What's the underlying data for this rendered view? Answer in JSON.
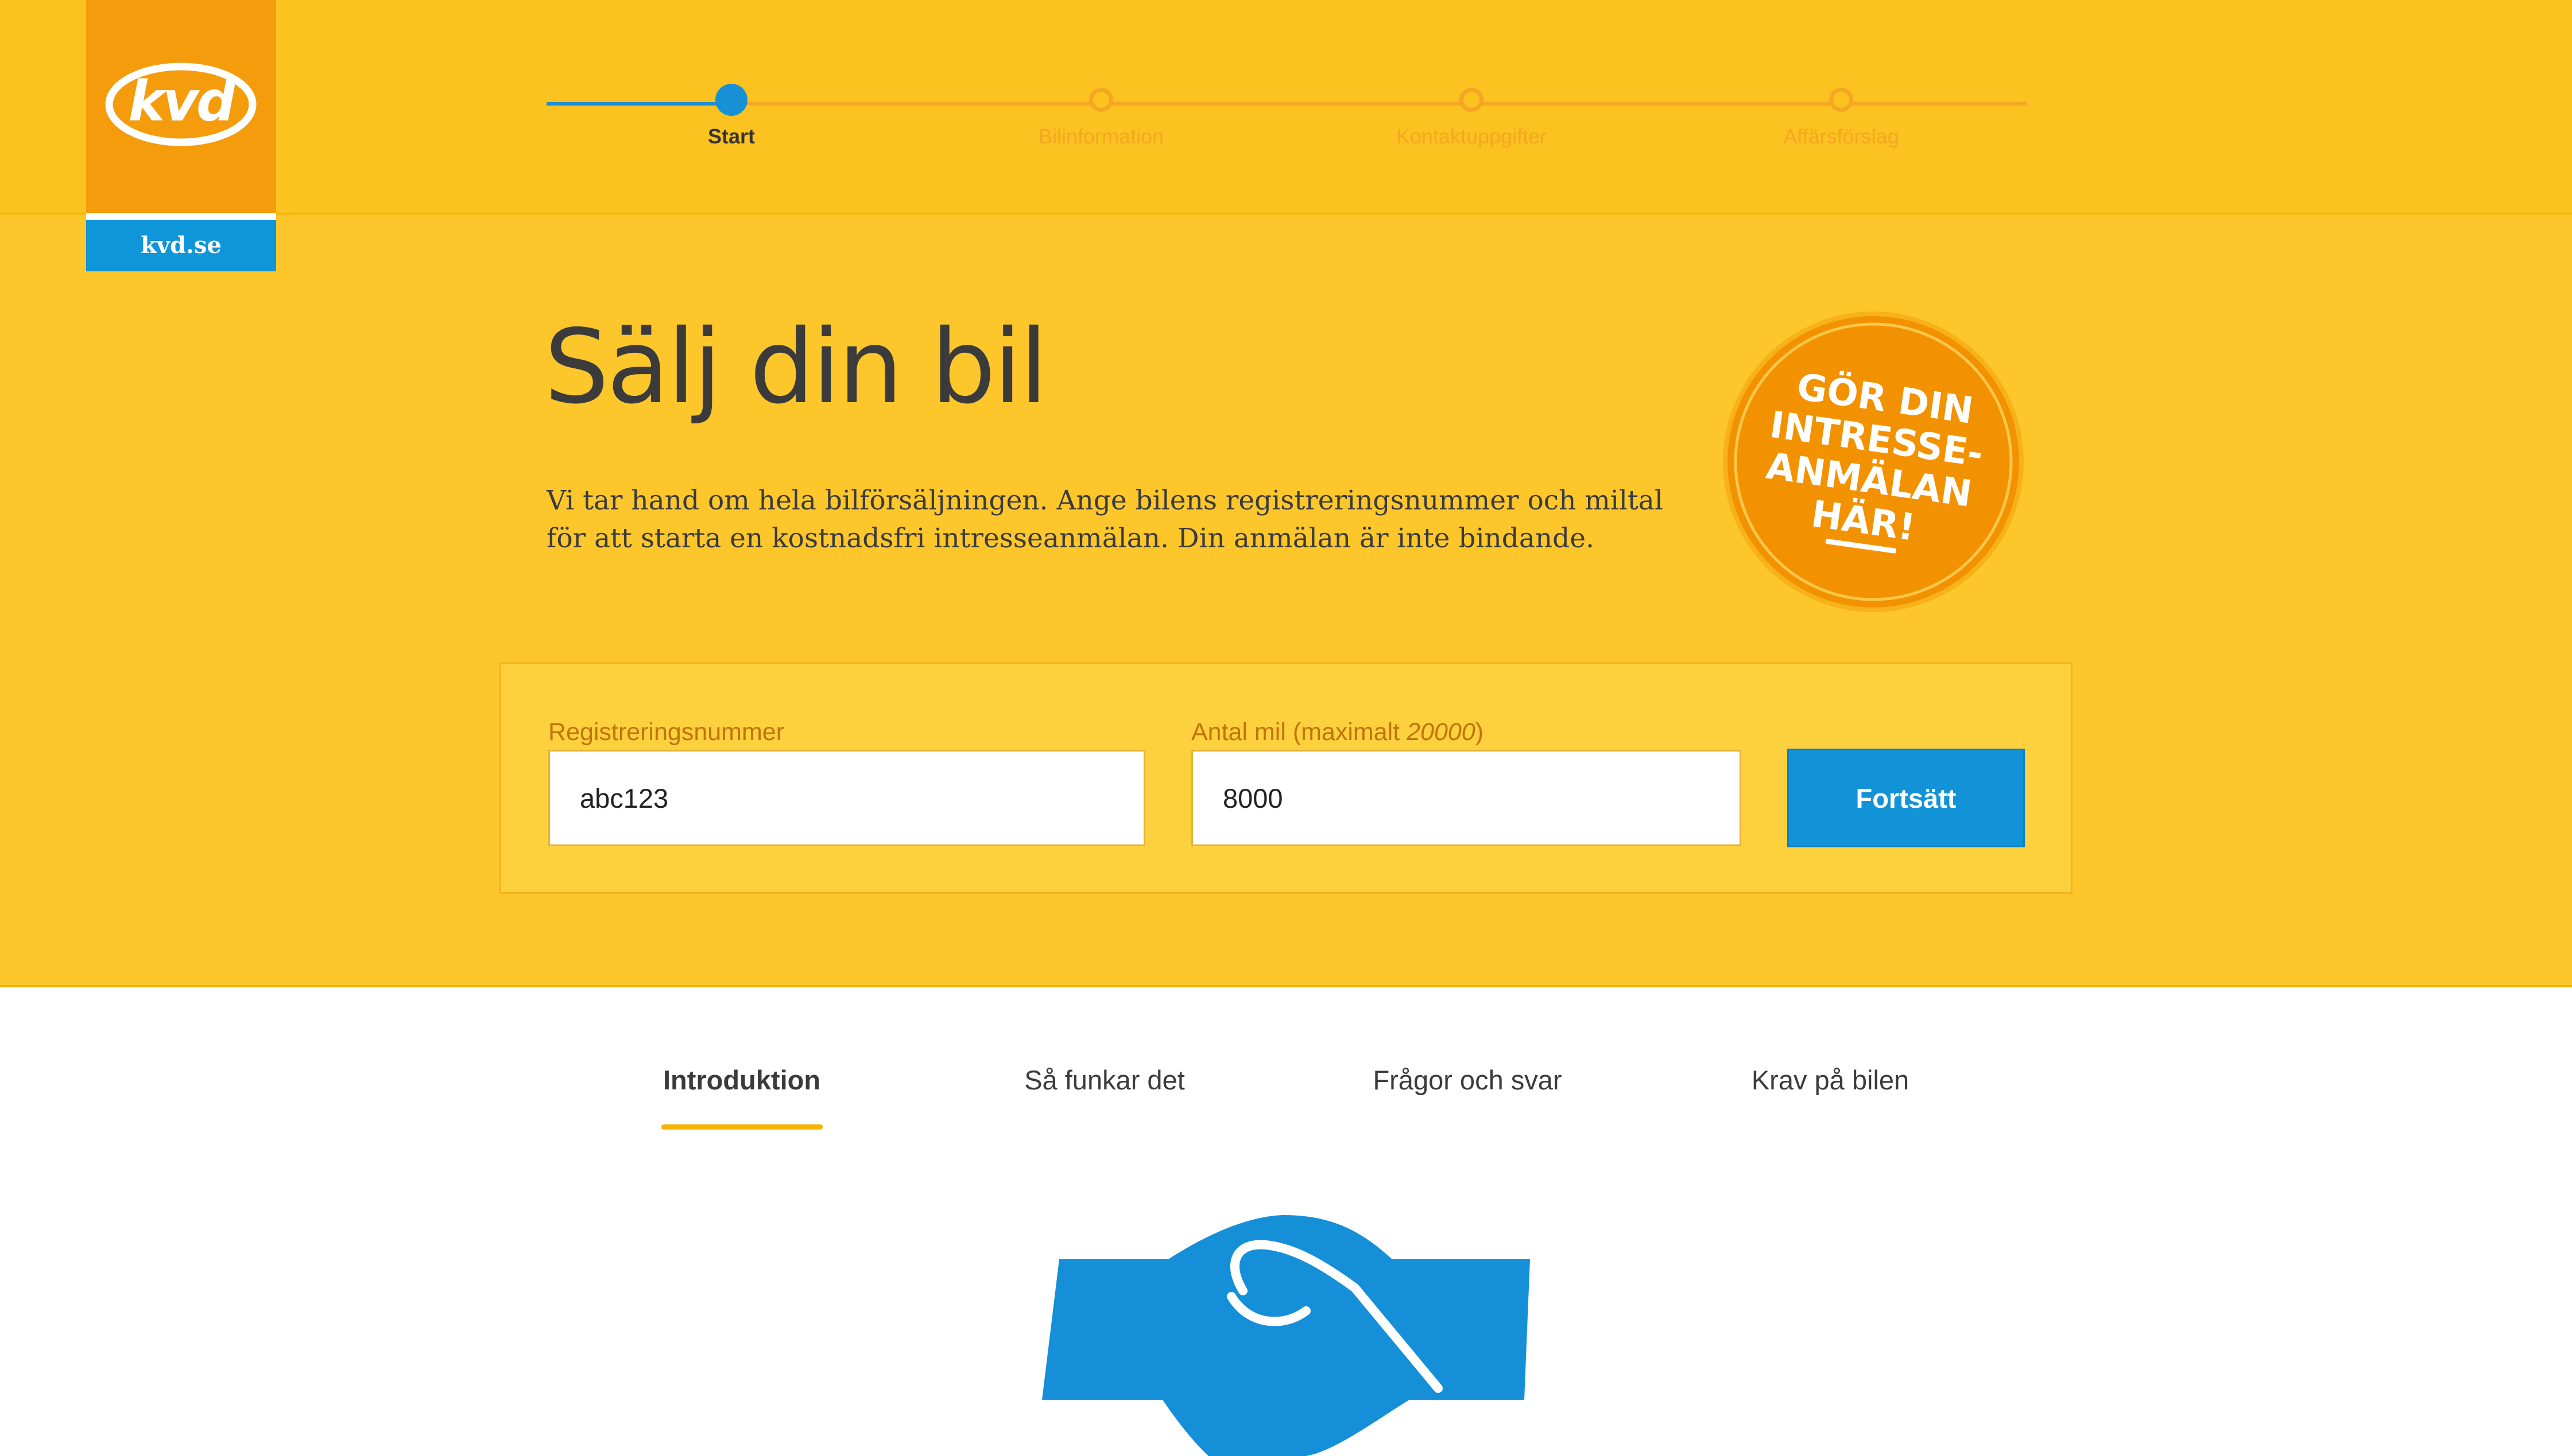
{
  "brand": {
    "logo_text": "kvd",
    "site_link": "kvd.se",
    "colors": {
      "header_yellow": "#fcc21f",
      "hero_yellow": "#fdc72c",
      "logo_orange": "#f49c0b",
      "accent_blue": "#1293d8",
      "badge_orange": "#f39200"
    }
  },
  "steps": [
    {
      "label": "Start",
      "state": "active"
    },
    {
      "label": "Bilinformation",
      "state": "todo"
    },
    {
      "label": "Kontaktuppgifter",
      "state": "todo"
    },
    {
      "label": "Affärsförslag",
      "state": "todo"
    }
  ],
  "hero": {
    "title": "Sälj din bil",
    "intro": "Vi tar hand om hela bilförsäljningen. Ange bilens registreringsnummer och miltal för att starta en kostnadsfri intresseanmälan. Din anmälan är inte bindande.",
    "badge_lines": [
      "GÖR DIN",
      "INTRESSE-",
      "ANMÄLAN",
      "HÄR!"
    ]
  },
  "form": {
    "reg_label": "Registreringsnummer",
    "reg_value": "abc123",
    "mil_label": "Antal mil (maximalt ",
    "mil_max": "20000",
    "mil_label_end": ")",
    "mil_value": "8000",
    "submit_label": "Fortsätt"
  },
  "tabs": [
    {
      "label": "Introduktion",
      "active": true
    },
    {
      "label": "Så funkar det",
      "active": false
    },
    {
      "label": "Frågor och svar",
      "active": false
    },
    {
      "label": "Krav på bilen",
      "active": false
    }
  ],
  "icons": {
    "logo": "kvd-logo-icon",
    "badge": "orange-stamp-badge",
    "illustration": "handshake-icon"
  }
}
